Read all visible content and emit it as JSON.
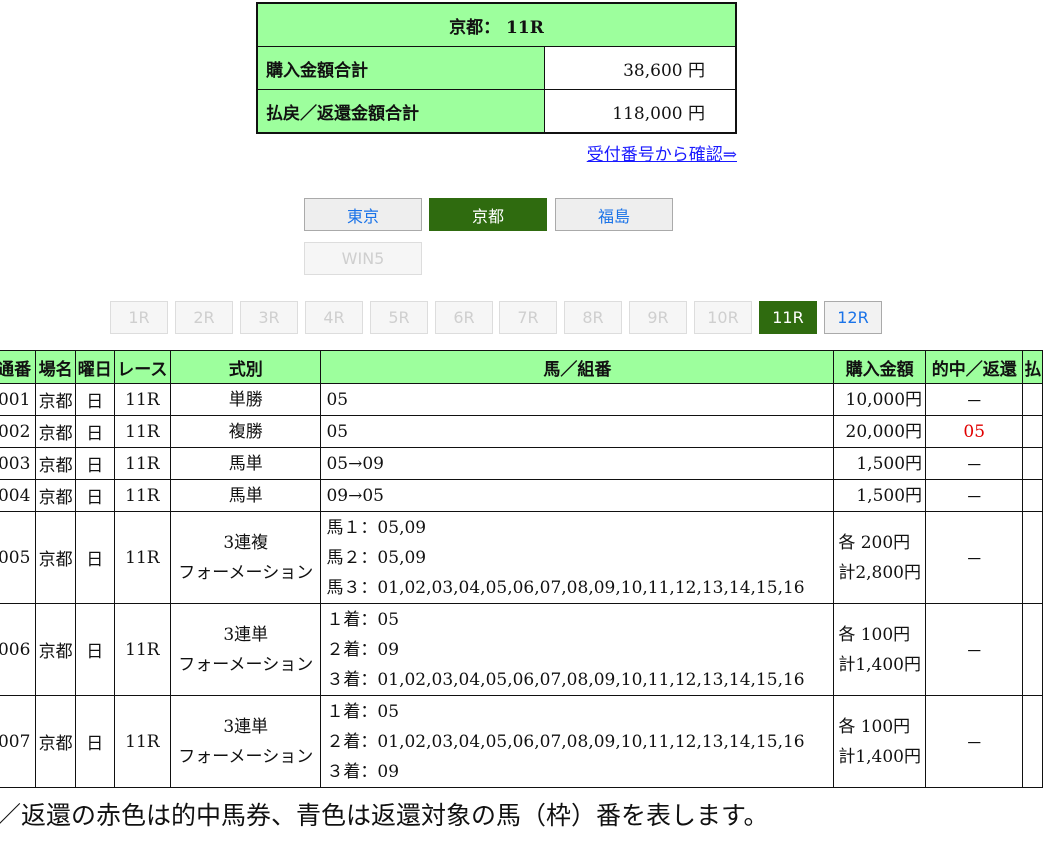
{
  "summary": {
    "title": "京都： 11R",
    "purchase_label": "購入金額合計",
    "purchase_value": "38,600 円",
    "refund_label": "払戻／返還金額合計",
    "refund_value": "118,000 円"
  },
  "confirm_link": "受付番号から確認⇒",
  "venues": [
    "東京",
    "京都",
    "福島"
  ],
  "win5": "WIN5",
  "races": [
    "1R",
    "2R",
    "3R",
    "4R",
    "5R",
    "6R",
    "7R",
    "8R",
    "9R",
    "10R",
    "11R",
    "12R"
  ],
  "table": {
    "headers": [
      "通番",
      "場名",
      "曜日",
      "レース",
      "式別",
      "馬／組番",
      "購入金額",
      "的中／返還",
      "払"
    ],
    "rows": [
      {
        "no": "001",
        "venue": "京都",
        "day": "日",
        "race": "11R",
        "type": [
          "単勝"
        ],
        "combo": [
          "05"
        ],
        "amount": [
          "10,000円"
        ],
        "result": "－",
        "hit": false
      },
      {
        "no": "002",
        "venue": "京都",
        "day": "日",
        "race": "11R",
        "type": [
          "複勝"
        ],
        "combo": [
          "05"
        ],
        "amount": [
          "20,000円"
        ],
        "result": "05",
        "hit": true
      },
      {
        "no": "003",
        "venue": "京都",
        "day": "日",
        "race": "11R",
        "type": [
          "馬単"
        ],
        "combo": [
          "05→09"
        ],
        "amount": [
          "1,500円"
        ],
        "result": "－",
        "hit": false
      },
      {
        "no": "004",
        "venue": "京都",
        "day": "日",
        "race": "11R",
        "type": [
          "馬単"
        ],
        "combo": [
          "09→05"
        ],
        "amount": [
          "1,500円"
        ],
        "result": "－",
        "hit": false
      },
      {
        "no": "005",
        "venue": "京都",
        "day": "日",
        "race": "11R",
        "type": [
          "3連複",
          "フォーメーション"
        ],
        "combo": [
          "馬１：05,09",
          "馬２：05,09",
          "馬３：01,02,03,04,05,06,07,08,09,10,11,12,13,14,15,16"
        ],
        "amount": [
          "各 200円",
          "計2,800円"
        ],
        "result": "－",
        "hit": false
      },
      {
        "no": "006",
        "venue": "京都",
        "day": "日",
        "race": "11R",
        "type": [
          "3連単",
          "フォーメーション"
        ],
        "combo": [
          "１着：05",
          "２着：09",
          "３着：01,02,03,04,05,06,07,08,09,10,11,12,13,14,15,16"
        ],
        "amount": [
          "各 100円",
          "計1,400円"
        ],
        "result": "－",
        "hit": false
      },
      {
        "no": "007",
        "venue": "京都",
        "day": "日",
        "race": "11R",
        "type": [
          "3連単",
          "フォーメーション"
        ],
        "combo": [
          "１着：05",
          "２着：01,02,03,04,05,06,07,08,09,10,11,12,13,14,15,16",
          "３着：09"
        ],
        "amount": [
          "各 100円",
          "計1,400円"
        ],
        "result": "－",
        "hit": false
      }
    ]
  },
  "note": "／返還の赤色は的中馬券、青色は返還対象の馬（枠）番を表します。"
}
